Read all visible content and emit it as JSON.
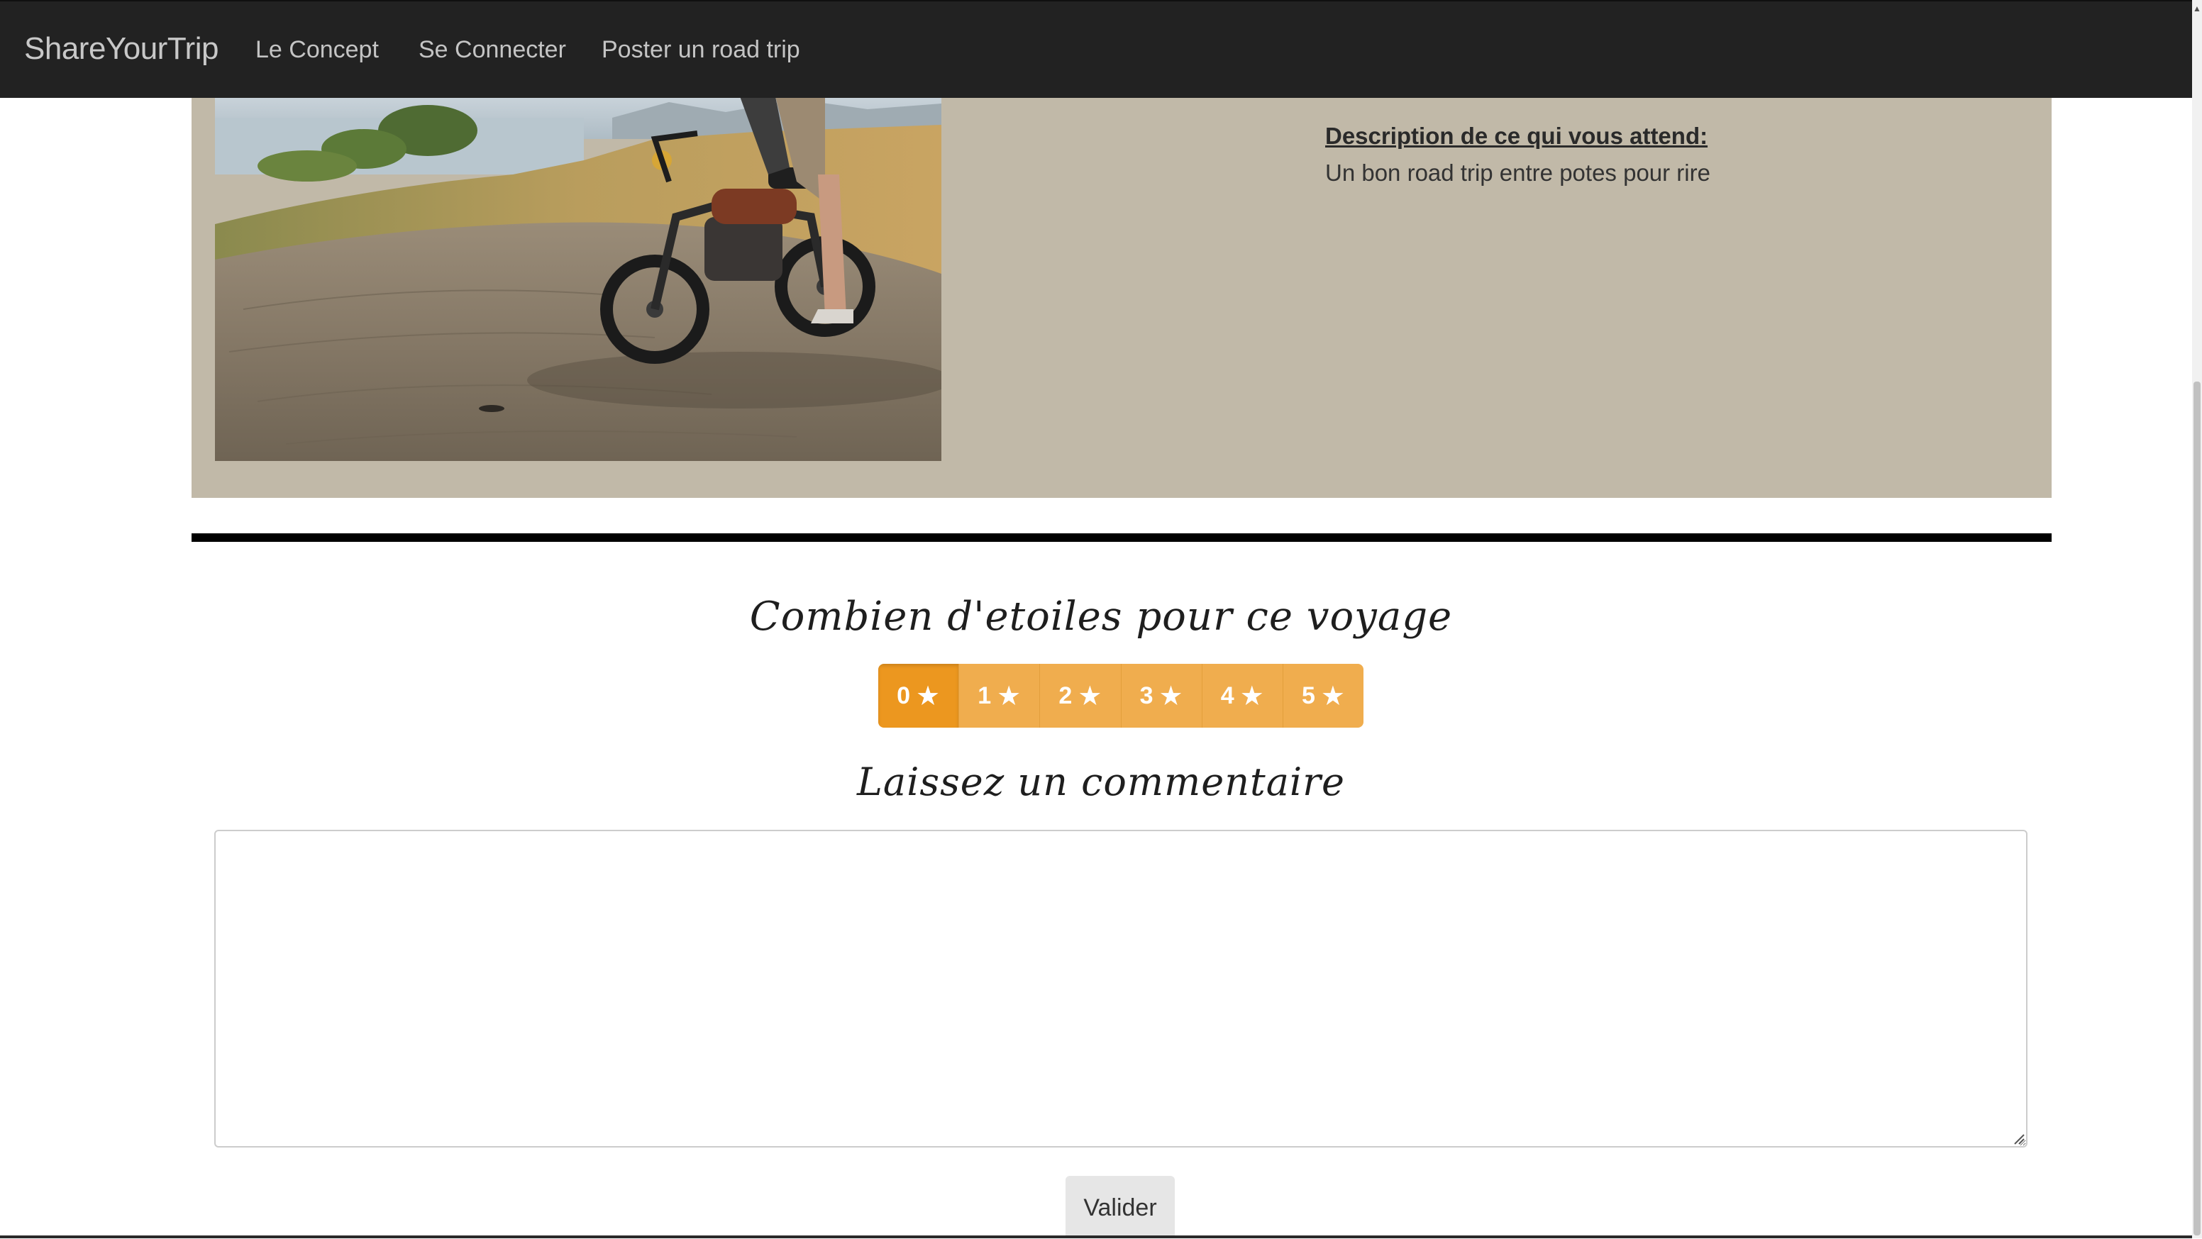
{
  "navbar": {
    "brand": "ShareYourTrip",
    "links": [
      {
        "label": "Le Concept"
      },
      {
        "label": "Se Connecter"
      },
      {
        "label": "Poster un road trip"
      }
    ]
  },
  "trip": {
    "photo_icon": "motorcycle-photo",
    "description_title": "Description de ce qui vous attend:",
    "description_text": "Un bon road trip entre potes pour rire"
  },
  "rating": {
    "title": "Combien d'etoiles pour ce voyage",
    "selected": 0,
    "options": [
      {
        "value": "0",
        "label": "0"
      },
      {
        "value": "1",
        "label": "1"
      },
      {
        "value": "2",
        "label": "2"
      },
      {
        "value": "3",
        "label": "3"
      },
      {
        "value": "4",
        "label": "4"
      },
      {
        "value": "5",
        "label": "5"
      }
    ],
    "star_glyph": "★",
    "color": "#f0ad4e",
    "active_color": "#ec971f"
  },
  "comment": {
    "title": "Laissez un commentaire",
    "value": "",
    "placeholder": ""
  },
  "submit": {
    "label": "Valider"
  },
  "colors": {
    "navbar_bg": "#222222",
    "panel_bg": "#c1b9a8"
  }
}
